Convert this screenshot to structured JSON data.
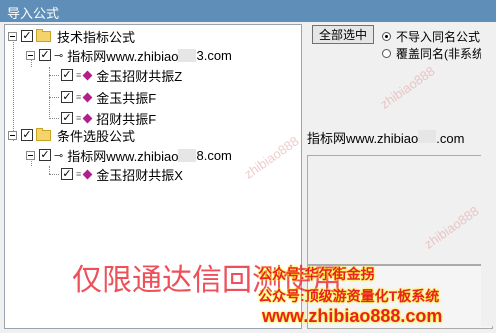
{
  "window": {
    "title": "导入公式"
  },
  "tree": {
    "groups": [
      {
        "label": "技术指标公式",
        "child": "指标网www.zhibiao",
        "child_suffix": "3.com",
        "leaves": [
          "金玉招财共振Z",
          "金玉共振F",
          "招财共振F"
        ]
      },
      {
        "label": "条件选股公式",
        "child": "指标网www.zhibiao",
        "child_suffix": "8.com",
        "leaves": [
          "金玉招财共振X"
        ]
      }
    ]
  },
  "buttons": {
    "select_all": "全部选中"
  },
  "options": {
    "no_import": "不导入同名公式",
    "overwrite": "覆盖同名(非系统)"
  },
  "info": {
    "site": "指标网www.zhibiao",
    "site_suffix": ".com"
  },
  "watermarks": {
    "main": "仅限通达信回测使用",
    "line1": "公众号:华尔街金拐",
    "line2": "公众号:顶级游资量化T板系统",
    "line3": "www.zhibiao888.com",
    "diag": "zhibiao888"
  },
  "colors": {
    "accent": "#5f8fb8",
    "watermark": "#e8202a",
    "diamond": "#b21f8c"
  }
}
